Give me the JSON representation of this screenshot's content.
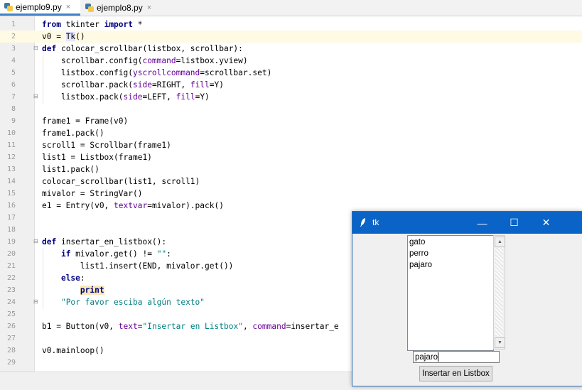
{
  "tabs": [
    {
      "label": "ejemplo9.py",
      "active": true
    },
    {
      "label": "ejemplo8.py",
      "active": false
    }
  ],
  "tab_close_glyph": "×",
  "line_numbers": [
    "1",
    "2",
    "3",
    "4",
    "5",
    "6",
    "7",
    "8",
    "9",
    "10",
    "11",
    "12",
    "13",
    "14",
    "15",
    "16",
    "17",
    "18",
    "19",
    "20",
    "21",
    "22",
    "23",
    "24",
    "25",
    "26",
    "27",
    "28",
    "29"
  ],
  "code": {
    "l1_kw1": "from",
    "l1_mid": " tkinter ",
    "l1_kw2": "import",
    "l1_end": " *",
    "l2_a": "v0 = ",
    "l2_b": "Tk",
    "l2_c": "()",
    "l3_kw": "def",
    "l3_rest": " colocar_scrollbar(listbox, scrollbar):",
    "l4_a": "    scrollbar.config(",
    "l4_k": "command",
    "l4_b": "=listbox.yview)",
    "l5_a": "    listbox.config(",
    "l5_k": "yscrollcommand",
    "l5_b": "=scrollbar.set)",
    "l6_a": "    scrollbar.pack(",
    "l6_k1": "side",
    "l6_b": "=RIGHT, ",
    "l6_k2": "fill",
    "l6_c": "=Y)",
    "l7_a": "    listbox.pack(",
    "l7_k1": "side",
    "l7_b": "=LEFT, ",
    "l7_k2": "fill",
    "l7_c": "=Y)",
    "l9": "frame1 = Frame(v0)",
    "l10": "frame1.pack()",
    "l11": "scroll1 = Scrollbar(frame1)",
    "l12": "list1 = Listbox(frame1)",
    "l13": "list1.pack()",
    "l14": "colocar_scrollbar(list1, scroll1)",
    "l15": "mivalor = StringVar()",
    "l16_a": "e1 = Entry(v0, ",
    "l16_k": "textvar",
    "l16_b": "=mivalor).pack()",
    "l19_kw": "def",
    "l19_rest": " insertar_en_listbox():",
    "l20_a": "    ",
    "l20_kw": "if",
    "l20_b": " mivalor.get() != ",
    "l20_s": "\"\"",
    "l20_c": ":",
    "l21": "        list1.insert(END, mivalor.get())",
    "l22_a": "    ",
    "l22_kw": "else",
    "l22_b": ":",
    "l23_a": "        ",
    "l23_kw": "print",
    "l24_a": "    ",
    "l24_s": "\"Por favor esciba algún texto\"",
    "l26_a": "b1 = Button(v0, ",
    "l26_k1": "text",
    "l26_b": "=",
    "l26_s": "\"Insertar en Listbox\"",
    "l26_c": ", ",
    "l26_k2": "command",
    "l26_d": "=insertar_e",
    "l28": "v0.mainloop()"
  },
  "tk_window": {
    "title": "tk",
    "minimize": "—",
    "maximize": "☐",
    "close": "✕",
    "listbox_items": [
      "gato",
      "perro",
      "pajaro"
    ],
    "entry_value": "pajaro",
    "button_label": "Insertar en Listbox",
    "scroll_up": "▲",
    "scroll_down": "▼"
  }
}
